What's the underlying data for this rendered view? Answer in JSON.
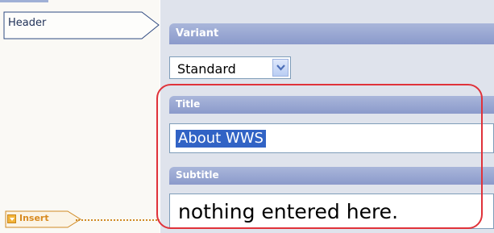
{
  "left": {
    "header_tab_label": "Header",
    "insert_label": "Insert"
  },
  "variant": {
    "section_label": "Variant",
    "selected": "Standard"
  },
  "title": {
    "section_label": "Title",
    "value": "About WWS"
  },
  "subtitle": {
    "section_label": "Subtitle",
    "value": "nothing entered here."
  },
  "colors": {
    "section_bar": "#8b9acb",
    "highlight_outline": "#e0323a",
    "selection": "#3163c5",
    "insert_accent": "#d88a20"
  },
  "icons": {
    "dropdown": "chevron-down-icon",
    "insert": "insert-arrow-icon"
  }
}
